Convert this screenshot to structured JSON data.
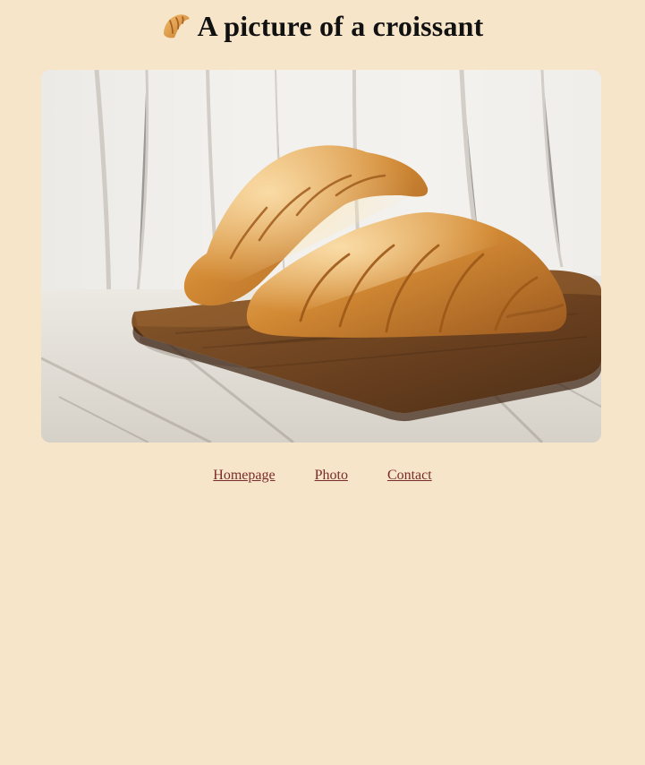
{
  "header": {
    "title": "A picture of a croissant",
    "logo_icon": "croissant-icon"
  },
  "photo": {
    "alt": "Two croissants on a wooden board",
    "subject": "croissant-photo"
  },
  "nav": {
    "homepage_label": "Homepage",
    "photo_label": "Photo",
    "contact_label": "Contact"
  },
  "colors": {
    "page_background": "#f7e5c9",
    "link": "#7a2c2c",
    "title": "#111111",
    "croissant": "#d88f38"
  }
}
